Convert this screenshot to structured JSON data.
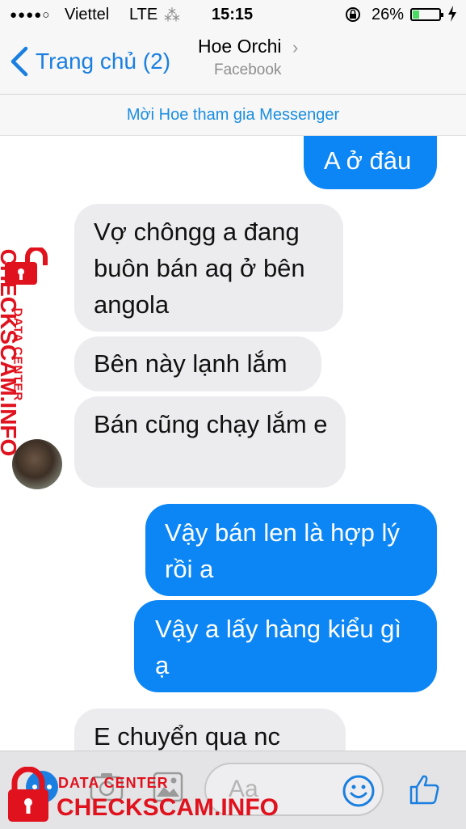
{
  "status_bar": {
    "signal": "●●●●○",
    "carrier": "Viettel",
    "network": "LTE",
    "spinner": "⁂",
    "time": "15:15",
    "battery_pct": "26%",
    "battery_level": 0.26
  },
  "nav": {
    "back_label": "Trang chủ (2)",
    "contact_name": "Hoe Orchi",
    "chevron": "›",
    "subtitle": "Facebook"
  },
  "invite_banner": "Mời Hoe tham gia Messenger",
  "messages": [
    {
      "dir": "out",
      "text": "A ở đâu"
    },
    {
      "dir": "in",
      "text": "Vợ chôngg a đang buôn bán aq ở bên angola"
    },
    {
      "dir": "in",
      "text": "Bên này lạnh lắm"
    },
    {
      "dir": "in",
      "text": "Bán cũng chạy lắm e"
    },
    {
      "dir": "out",
      "text": "Vậy bán len là hợp lý rồi a"
    },
    {
      "dir": "out",
      "text": "Vậy a lấy hàng kiểu gì ạ"
    },
    {
      "dir": "in",
      "text": "E chuyển qua nc"
    }
  ],
  "composer": {
    "placeholder": "Aa"
  },
  "watermark": {
    "side_small": "DATA CENTER",
    "side_large": "CHECKSCAM.INFO",
    "bottom_small": "DATA CENTER",
    "bottom_large": "CHECKSCAM.INFO"
  },
  "colors": {
    "accent": "#1a7fe0",
    "outgoing_bubble": "#0d86f5",
    "incoming_bubble": "#ececee",
    "watermark": "#e0121e"
  }
}
